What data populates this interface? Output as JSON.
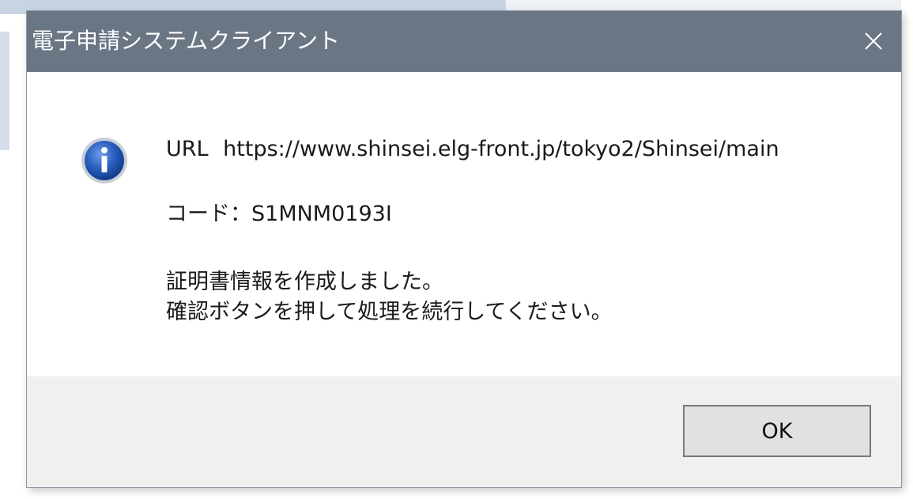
{
  "dialog": {
    "title": "電子申請システムクライアント",
    "close_icon": "close-icon",
    "icon": "info-icon",
    "url_label": "URL",
    "url_value": "https://www.shinsei.elg-front.jp/tokyo2/Shinsei/main",
    "code_line": "コード：S1MNM0193I",
    "message_line1": "証明書情報を作成しました。",
    "message_line2": "確認ボタンを押して処理を続行してください。",
    "ok_label": "OK"
  },
  "colors": {
    "titlebar": "#6b7685",
    "title_text": "#ffffff",
    "footer": "#f0f0f0",
    "icon_blue": "#2457b8"
  }
}
